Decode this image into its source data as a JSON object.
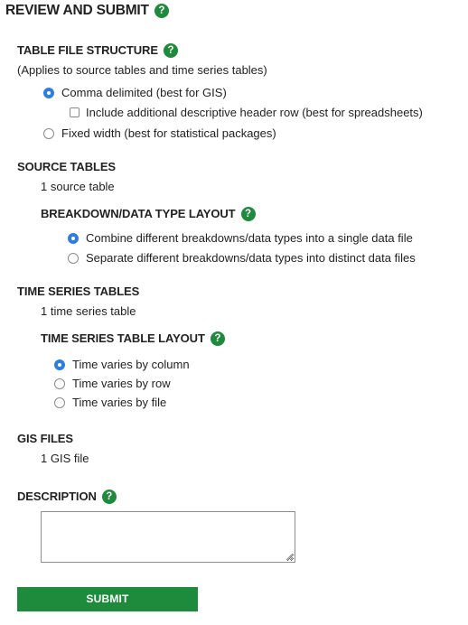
{
  "page_title": "REVIEW AND SUBMIT",
  "help_glyph": "?",
  "table_file_structure": {
    "heading": "TABLE FILE STRUCTURE",
    "note": "(Applies to source tables and time series tables)",
    "options": [
      {
        "label": "Comma delimited (best for GIS)",
        "selected": true
      },
      {
        "label": "Fixed width (best for statistical packages)",
        "selected": false
      }
    ],
    "header_row_checkbox": {
      "label": "Include additional descriptive header row (best for spreadsheets)",
      "checked": false
    }
  },
  "source_tables": {
    "heading": "SOURCE TABLES",
    "count_text": "1 source table",
    "layout_heading": "BREAKDOWN/DATA TYPE LAYOUT",
    "options": [
      {
        "label": "Combine different breakdowns/data types into a single data file",
        "selected": true
      },
      {
        "label": "Separate different breakdowns/data types into distinct data files",
        "selected": false
      }
    ]
  },
  "time_series_tables": {
    "heading": "TIME SERIES TABLES",
    "count_text": "1 time series table",
    "layout_heading": "TIME SERIES TABLE LAYOUT",
    "options": [
      {
        "label": "Time varies by column",
        "selected": true
      },
      {
        "label": "Time varies by row",
        "selected": false
      },
      {
        "label": "Time varies by file",
        "selected": false
      }
    ]
  },
  "gis_files": {
    "heading": "GIS FILES",
    "count_text": "1 GIS file"
  },
  "description": {
    "heading": "DESCRIPTION",
    "value": ""
  },
  "submit_label": "SUBMIT",
  "colors": {
    "accent_green": "#1e8a3c",
    "radio_selected": "#2f7de1",
    "text": "#222222"
  }
}
